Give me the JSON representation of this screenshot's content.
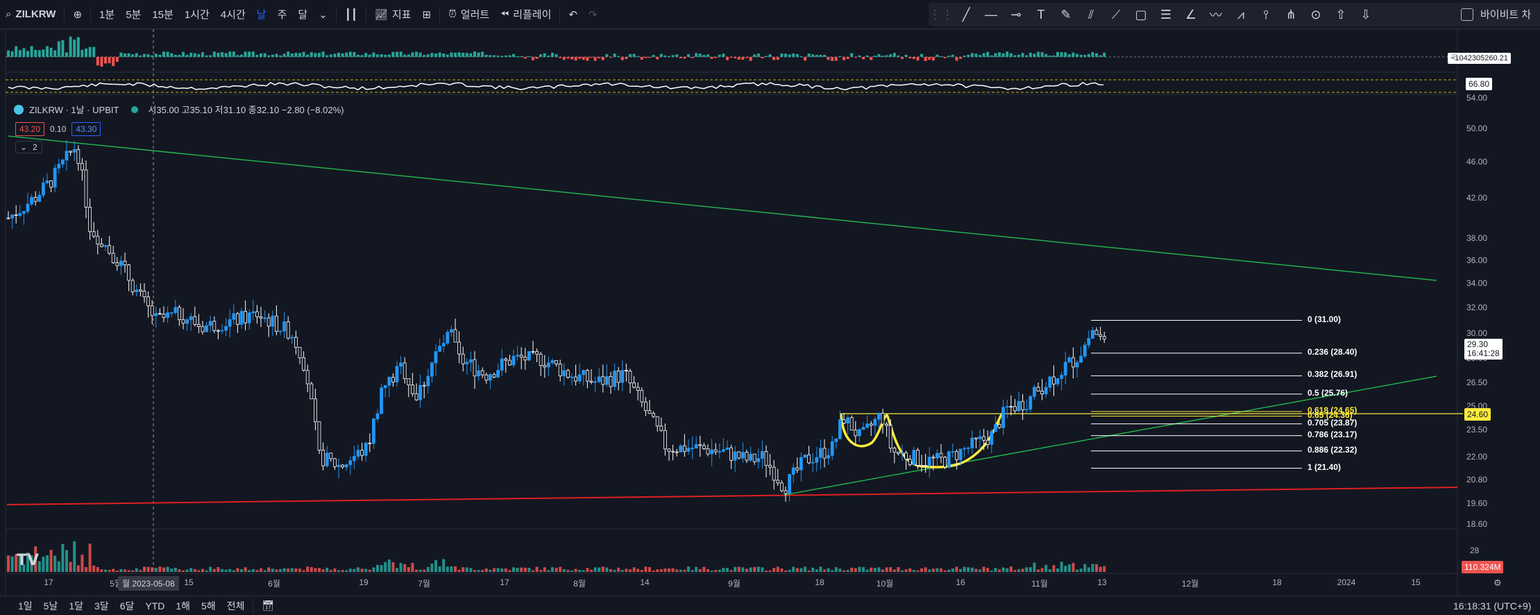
{
  "toolbar": {
    "symbol": "ZILKRW",
    "intervals": [
      "1분",
      "5분",
      "15분",
      "1시간",
      "4시간",
      "날",
      "주",
      "달"
    ],
    "active_interval": "날",
    "indicators_label": "지표",
    "alerts_label": "얼러트",
    "replay_label": "리플레이",
    "right_label": "바이비트 차"
  },
  "legend": {
    "title": "ZILKRW · 1날 · UPBIT",
    "ohlc": "시35.00  고35.10  저31.10  종32.10  −2.80 (−8.02%)",
    "bid": "43.20",
    "spread": "0.10",
    "ask": "43.30",
    "collapse": "2"
  },
  "price_axis": {
    "ticks": [
      "54.00",
      "50.00",
      "46.00",
      "42.00",
      "38.00",
      "36.00",
      "34.00",
      "32.00",
      "30.00",
      "28.00",
      "26.50",
      "25.00",
      "23.50",
      "22.00",
      "20.80",
      "19.60",
      "18.60"
    ],
    "last_price": "29.30",
    "countdown": "16:41:28",
    "level_price": "24.60",
    "osc_value": "66.80",
    "macd_value": "−1042305260.21",
    "volume_value": "110.324M",
    "volume_tick": "28"
  },
  "time_axis": {
    "labels": [
      "17",
      "5월",
      "15",
      "6월",
      "19",
      "7월",
      "17",
      "8월",
      "14",
      "9월",
      "18",
      "10월",
      "16",
      "11월",
      "13",
      "12월",
      "18",
      "2024",
      "15"
    ],
    "crosshair_date": "월 2023-05-08"
  },
  "fib": [
    {
      "ratio": "0 (31.00)",
      "price": 31.0
    },
    {
      "ratio": "0.236 (28.40)",
      "price": 28.4
    },
    {
      "ratio": "0.382 (26.91)",
      "price": 26.91
    },
    {
      "ratio": "0.5 (25.76)",
      "price": 25.76
    },
    {
      "ratio": "0.618 (24.65)",
      "price": 24.65
    },
    {
      "ratio": "0.65 (24.36)",
      "price": 24.36
    },
    {
      "ratio": "0.705 (23.87)",
      "price": 23.87
    },
    {
      "ratio": "0.786 (23.17)",
      "price": 23.17
    },
    {
      "ratio": "0.886 (22.32)",
      "price": 22.32
    },
    {
      "ratio": "1 (21.40)",
      "price": 21.4
    }
  ],
  "bottom": {
    "ranges": [
      "1일",
      "5날",
      "1달",
      "3달",
      "6달",
      "YTD",
      "1해",
      "5해",
      "전체"
    ],
    "clock": "16:18:31 (UTC+9)"
  },
  "colors": {
    "up": "#26a69a",
    "up_candle": "#2196f3",
    "down": "#ef5350",
    "downtrend_line": "#22b14c",
    "support_line": "#e02020",
    "highlight": "#ffeb3b"
  }
}
